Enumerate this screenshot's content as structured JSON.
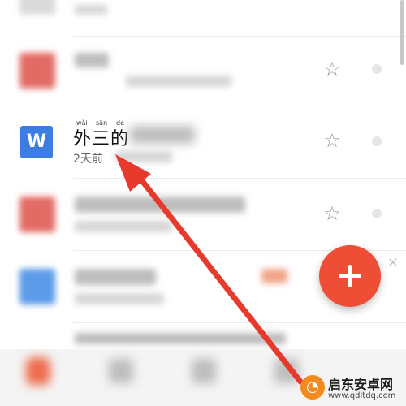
{
  "document_item": {
    "title_chars": [
      "外",
      "三",
      "的"
    ],
    "pinyin": [
      "wài",
      "sān",
      "de"
    ],
    "subtitle": "2天前",
    "app_icon_letter": "W"
  },
  "fab": {
    "icon": "plus-icon",
    "close_icon": "close-icon"
  },
  "colors": {
    "fab": "#ee4d36",
    "wps_blue": "#3b7de0",
    "arrow": "#e83a2c",
    "red_tile": "#e36b66",
    "blue_tile": "#5b9be8"
  },
  "icons": {
    "favorite": "star-outline-icon",
    "status": "status-dot-icon"
  },
  "watermark": {
    "brand": "启东安卓网",
    "url": "www.qdltdq.com"
  }
}
